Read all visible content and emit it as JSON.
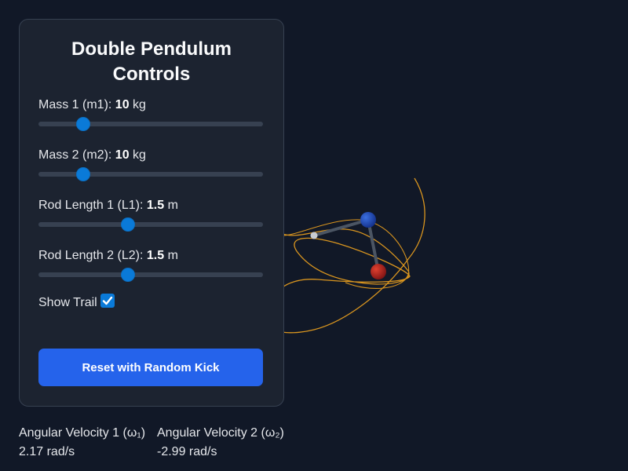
{
  "panel": {
    "title": "Double Pendulum Controls",
    "controls": [
      {
        "label": "Mass 1 (m1): ",
        "value": "10",
        "unit": " kg",
        "fraction": 0.2
      },
      {
        "label": "Mass 2 (m2): ",
        "value": "10",
        "unit": " kg",
        "fraction": 0.2
      },
      {
        "label": "Rod Length 1 (L1): ",
        "value": "1.5",
        "unit": " m",
        "fraction": 0.4
      },
      {
        "label": "Rod Length 2 (L2): ",
        "value": "1.5",
        "unit": " m",
        "fraction": 0.4
      }
    ],
    "trail_label": "Show Trail",
    "trail_checked": true,
    "reset_label": "Reset with Random Kick"
  },
  "readouts": {
    "w1_label": "Angular Velocity 1 (ω₁)",
    "w1_value": "2.17 rad/s",
    "w2_label": "Angular Velocity 2 (ω₂)",
    "w2_value": "-2.99 rad/s"
  },
  "colors": {
    "background": "#111827",
    "trail": "#e0a020",
    "bob1": "#1e40af",
    "bob2": "#b91c1c",
    "accent": "#2563eb"
  }
}
